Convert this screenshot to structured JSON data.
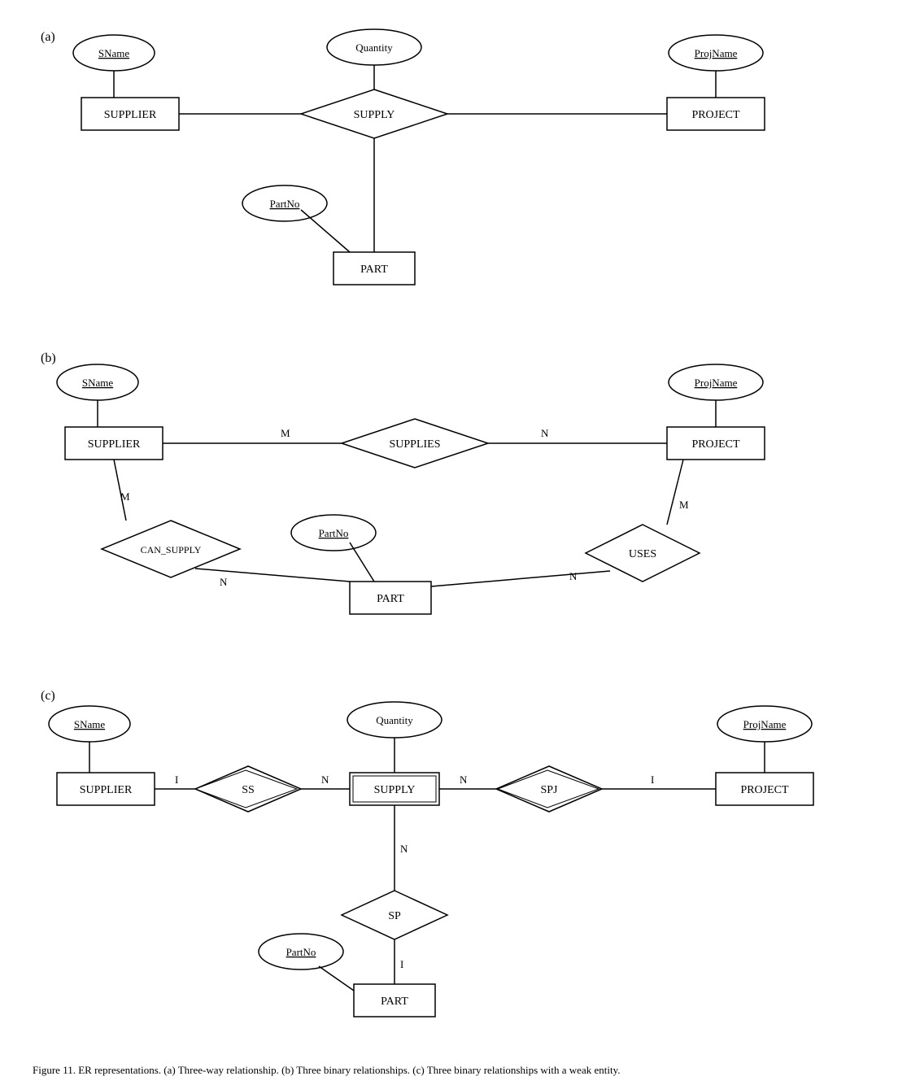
{
  "diagrams": {
    "a": {
      "label": "(a)",
      "entities": [
        {
          "id": "SUPPLIER",
          "text": "SUPPLIER"
        },
        {
          "id": "SUPPLY",
          "text": "SUPPLY"
        },
        {
          "id": "PROJECT",
          "text": "PROJECT"
        },
        {
          "id": "PART",
          "text": "PART"
        }
      ],
      "attributes": [
        {
          "id": "SName",
          "text": "SName",
          "underline": true
        },
        {
          "id": "Quantity",
          "text": "Quantity"
        },
        {
          "id": "ProjName",
          "text": "ProjName",
          "underline": true
        },
        {
          "id": "PartNo",
          "text": "PartNo",
          "underline": true
        }
      ],
      "relationships": [
        {
          "id": "SUPPLY_diamond",
          "text": "SUPPLY"
        }
      ]
    },
    "b": {
      "label": "(b)",
      "entities": [
        {
          "id": "SUPPLIER",
          "text": "SUPPLIER"
        },
        {
          "id": "PROJECT",
          "text": "PROJECT"
        },
        {
          "id": "PART",
          "text": "PART"
        }
      ],
      "attributes": [
        {
          "id": "SName",
          "text": "SName",
          "underline": true
        },
        {
          "id": "ProjName",
          "text": "ProjName",
          "underline": true
        },
        {
          "id": "PartNo",
          "text": "PartNo",
          "underline": true
        }
      ],
      "relationships": [
        {
          "id": "SUPPLIES",
          "text": "SUPPLIES"
        },
        {
          "id": "CAN_SUPPLY",
          "text": "CAN_SUPPLY"
        },
        {
          "id": "USES",
          "text": "USES"
        }
      ]
    },
    "c": {
      "label": "(c)",
      "entities": [
        {
          "id": "SUPPLIER",
          "text": "SUPPLIER"
        },
        {
          "id": "SUPPLY",
          "text": "SUPPLY"
        },
        {
          "id": "PROJECT",
          "text": "PROJECT"
        },
        {
          "id": "PART",
          "text": "PART"
        }
      ],
      "attributes": [
        {
          "id": "SName",
          "text": "SName",
          "underline": true
        },
        {
          "id": "Quantity",
          "text": "Quantity"
        },
        {
          "id": "ProjName",
          "text": "ProjName",
          "underline": true
        },
        {
          "id": "PartNo",
          "text": "PartNo",
          "underline": true
        }
      ],
      "relationships": [
        {
          "id": "SS",
          "text": "SS"
        },
        {
          "id": "SPJ",
          "text": "SPJ"
        },
        {
          "id": "SP",
          "text": "SP"
        }
      ]
    }
  },
  "caption": "Figure 11. ER representations. (a) Three-way relationship. (b) Three binary relationships. (c) Three binary relationships with a weak entity."
}
